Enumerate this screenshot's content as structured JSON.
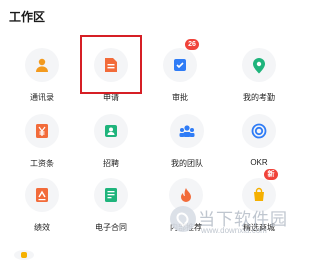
{
  "section_title": "工作区",
  "apps": [
    {
      "label": "通讯录",
      "icon": "contacts-icon",
      "color": "#f39a1e"
    },
    {
      "label": "申请",
      "icon": "document-icon",
      "color": "#f26b3a"
    },
    {
      "label": "审批",
      "icon": "approval-icon",
      "color": "#2f7cf6",
      "badge": "26"
    },
    {
      "label": "我的考勤",
      "icon": "location-pin-icon",
      "color": "#1fb47c"
    },
    {
      "label": "工资条",
      "icon": "yen-icon",
      "color": "#f26b3a"
    },
    {
      "label": "招聘",
      "icon": "recruit-icon",
      "color": "#1fb47c"
    },
    {
      "label": "我的团队",
      "icon": "team-icon",
      "color": "#2f7cf6"
    },
    {
      "label": "OKR",
      "icon": "target-icon",
      "color": "#2f7cf6"
    },
    {
      "label": "绩效",
      "icon": "performance-icon",
      "color": "#f26b3a"
    },
    {
      "label": "电子合同",
      "icon": "contract-icon",
      "color": "#1fb47c"
    },
    {
      "label": "内部推荐",
      "icon": "flame-icon",
      "color": "#f26b3a"
    },
    {
      "label": "精选商城",
      "icon": "mall-icon",
      "color": "#f5b000",
      "badge": "新"
    }
  ],
  "watermark": {
    "brand": "当下软件园",
    "url": "www.downxia.com"
  }
}
